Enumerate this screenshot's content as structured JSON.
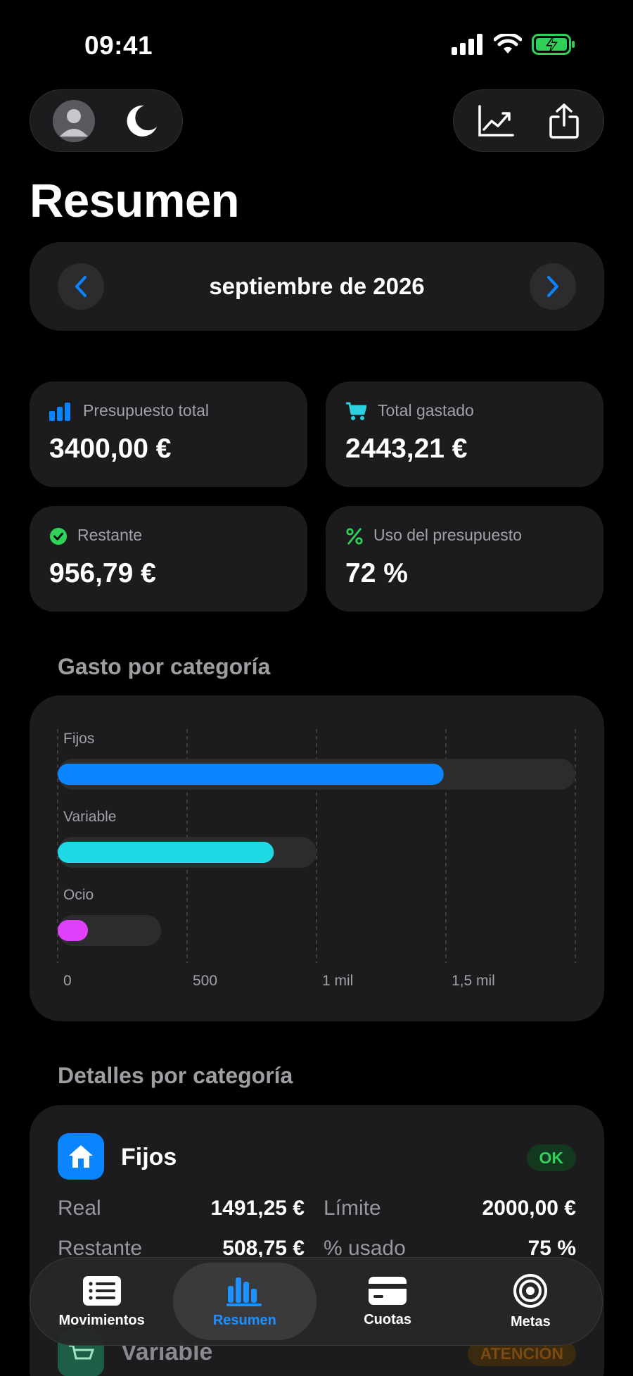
{
  "status_bar": {
    "time": "09:41"
  },
  "page": {
    "title": "Resumen"
  },
  "month_selector": {
    "label": "septiembre de 2026"
  },
  "stats": [
    {
      "label": "Presupuesto total",
      "value": "3400,00 €",
      "icon": "bar-chart-icon",
      "icon_color": "#0a84ff"
    },
    {
      "label": "Total gastado",
      "value": "2443,21 €",
      "icon": "cart-icon",
      "icon_color": "#2ecfe0"
    },
    {
      "label": "Restante",
      "value": "956,79 €",
      "icon": "checkmark-circle-icon",
      "icon_color": "#30d158"
    },
    {
      "label": "Uso del presupuesto",
      "value": "72 %",
      "icon": "percent-icon",
      "icon_color": "#30d158"
    }
  ],
  "chart_section": {
    "title": "Gasto por categoría"
  },
  "chart_data": {
    "type": "bar",
    "orientation": "horizontal",
    "categories": [
      "Fijos",
      "Variable",
      "Ocio"
    ],
    "series": [
      {
        "values": [
          1491.25,
          835,
          117
        ]
      }
    ],
    "limits": [
      2000,
      1000,
      400
    ],
    "colors": [
      "#0a84ff",
      "#1ed8e4",
      "#e040fb"
    ],
    "x_ticks": [
      "0",
      "500",
      "1 mil",
      "1,5 mil"
    ],
    "x_tick_values": [
      0,
      500,
      1000,
      1500
    ],
    "xlim": [
      0,
      2000
    ],
    "grid": true
  },
  "details_section": {
    "title": "Detalles por categoría"
  },
  "detail_cards": [
    {
      "name": "Fijos",
      "icon": "house-icon",
      "badge": "OK",
      "real_label": "Real",
      "real_value": "1491,25 €",
      "limit_label": "Límite",
      "limit_value": "2000,00 €",
      "remaining_label": "Restante",
      "remaining_value": "508,75 €",
      "used_label": "% usado",
      "used_value": "75 %"
    },
    {
      "name": "Variable",
      "icon": "cart-icon",
      "badge": "ATENCIÓN"
    }
  ],
  "tabbar": {
    "items": [
      {
        "label": "Movimientos",
        "icon": "list-icon"
      },
      {
        "label": "Resumen",
        "icon": "bar-chart-icon",
        "active": true
      },
      {
        "label": "Cuotas",
        "icon": "credit-card-icon"
      },
      {
        "label": "Metas",
        "icon": "target-icon"
      }
    ]
  }
}
